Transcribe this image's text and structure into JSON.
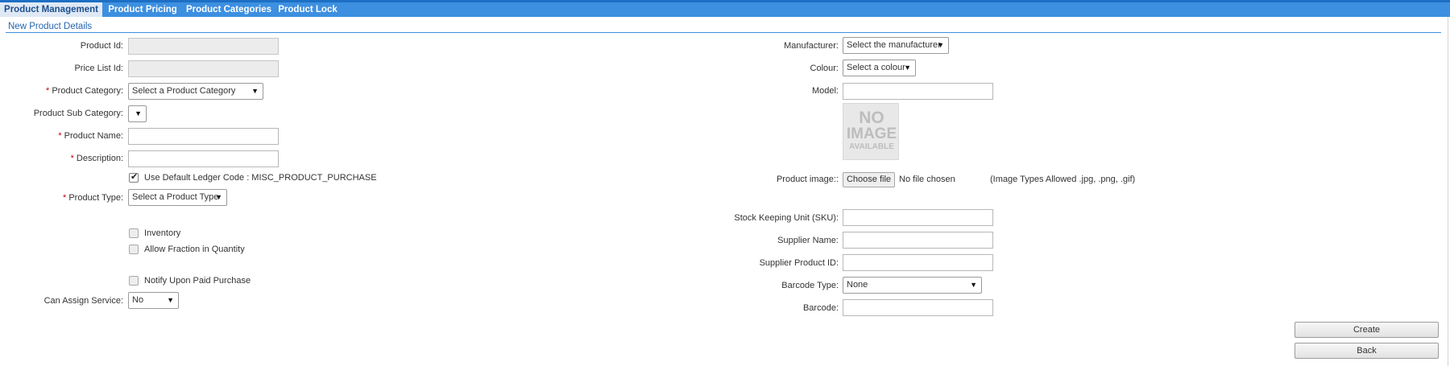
{
  "tabs": [
    {
      "label": "Product Management",
      "active": true
    },
    {
      "label": "Product Pricing"
    },
    {
      "label": "Product Categories"
    },
    {
      "label": "Product Lock"
    }
  ],
  "section_title": "New Product Details",
  "left": {
    "product_id": {
      "label": "Product Id:",
      "value": ""
    },
    "price_list_id": {
      "label": "Price List Id:",
      "value": ""
    },
    "product_category": {
      "required": "*",
      "label": "Product Category:",
      "selected": "Select a Product Category"
    },
    "product_sub_category": {
      "label": "Product Sub Category:",
      "selected": ""
    },
    "product_name": {
      "required": "*",
      "label": "Product Name:",
      "value": ""
    },
    "description": {
      "required": "*",
      "label": "Description:",
      "value": ""
    },
    "use_default_ledger": {
      "label": "Use Default Ledger Code : MISC_PRODUCT_PURCHASE",
      "checked": true
    },
    "product_type": {
      "required": "*",
      "label": "Product Type:",
      "selected": "Select a Product Type"
    },
    "inventory": {
      "label": "Inventory",
      "checked": false
    },
    "allow_fraction": {
      "label": "Allow Fraction in Quantity",
      "checked": false
    },
    "notify_paid": {
      "label": "Notify Upon Paid Purchase",
      "checked": false
    },
    "can_assign_service": {
      "label": "Can Assign Service:",
      "selected": "No"
    }
  },
  "right": {
    "manufacturer": {
      "label": "Manufacturer:",
      "selected": "Select the manufacturer"
    },
    "colour": {
      "label": "Colour:",
      "selected": "Select a colour"
    },
    "model": {
      "label": "Model:",
      "value": ""
    },
    "no_image": {
      "line1": "NO",
      "line2": "IMAGE",
      "line3": "AVAILABLE"
    },
    "product_image": {
      "label": "Product image::",
      "button": "Choose file",
      "status": "No file chosen",
      "hint": "(Image Types Allowed .jpg, .png, .gif)"
    },
    "sku": {
      "label": "Stock Keeping Unit (SKU):",
      "value": ""
    },
    "supplier_name": {
      "label": "Supplier Name:",
      "value": ""
    },
    "supplier_product_id": {
      "label": "Supplier Product ID:",
      "value": ""
    },
    "barcode_type": {
      "label": "Barcode Type:",
      "selected": "None"
    },
    "barcode": {
      "label": "Barcode:",
      "value": ""
    }
  },
  "actions": {
    "create": "Create",
    "back": "Back"
  }
}
